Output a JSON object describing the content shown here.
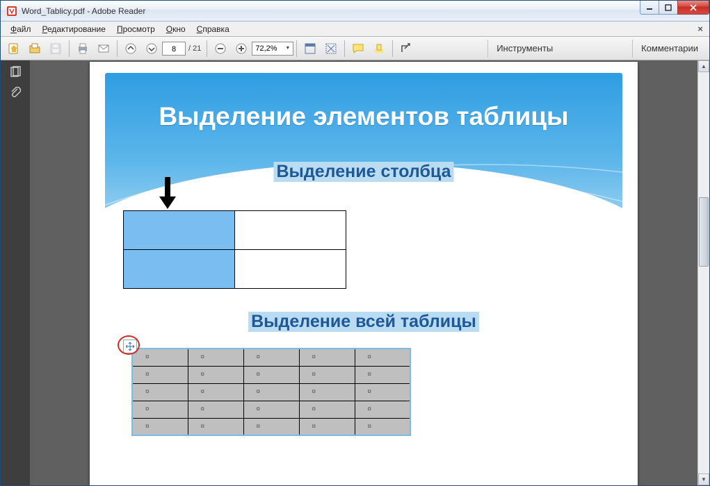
{
  "window": {
    "title": "Word_Tablicy.pdf - Adobe Reader"
  },
  "menu": {
    "file": "Файл",
    "edit": "Редактирование",
    "view": "Просмотр",
    "window": "Окно",
    "help": "Справка"
  },
  "toolbar": {
    "page_current": "8",
    "page_total": "/ 21",
    "zoom": "72,2%",
    "panel_tools": "Инструменты",
    "panel_comments": "Комментарии"
  },
  "slide": {
    "title": "Выделение элементов таблицы",
    "subtitle_column": "Выделение столбца",
    "subtitle_table": "Выделение всей таблицы",
    "cell_marker": "¤"
  }
}
